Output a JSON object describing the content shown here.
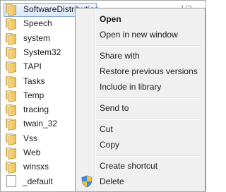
{
  "file_list": {
    "items": [
      {
        "name": "SoftwareDistribution",
        "type": "folder",
        "selected": true
      },
      {
        "name": "Speech",
        "type": "folder"
      },
      {
        "name": "system",
        "type": "folder"
      },
      {
        "name": "System32",
        "type": "folder"
      },
      {
        "name": "TAPI",
        "type": "folder"
      },
      {
        "name": "Tasks",
        "type": "folder"
      },
      {
        "name": "Temp",
        "type": "folder"
      },
      {
        "name": "tracing",
        "type": "folder"
      },
      {
        "name": "twain_32",
        "type": "folder"
      },
      {
        "name": "Vss",
        "type": "folder"
      },
      {
        "name": "Web",
        "type": "folder"
      },
      {
        "name": "winsxs",
        "type": "folder"
      },
      {
        "name": "_default",
        "type": "file"
      }
    ],
    "column_fragment": "1/2"
  },
  "context_menu": {
    "open": "Open",
    "open_new_window": "Open in new window",
    "share_with": "Share with",
    "restore_previous": "Restore previous versions",
    "include_library": "Include in library",
    "send_to": "Send to",
    "cut": "Cut",
    "copy": "Copy",
    "create_shortcut": "Create shortcut",
    "delete": "Delete"
  },
  "icons": {
    "folder": "folder-icon",
    "file": "file-icon",
    "shield": "shield-icon"
  },
  "colors": {
    "selection_border": "#7da2ce",
    "selection_fill": "#d9e8fb",
    "menu_bg": "#f0f0f0"
  }
}
